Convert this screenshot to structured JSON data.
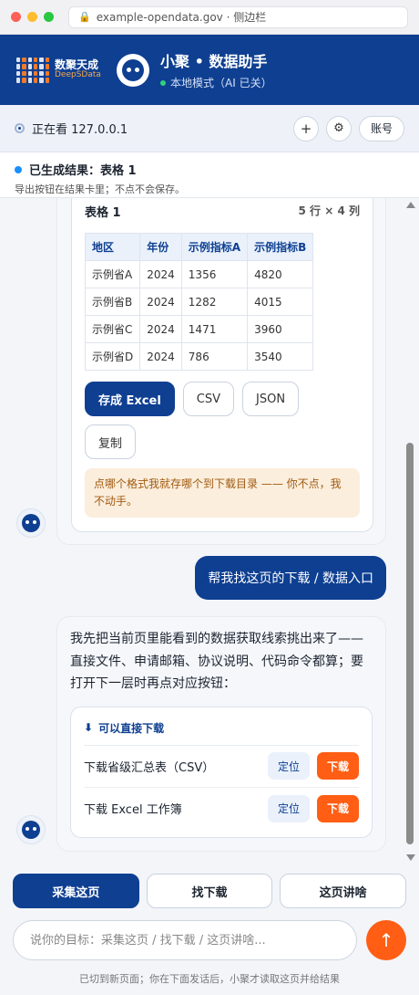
{
  "browser": {
    "url": "example-opendata.gov · 侧边栏"
  },
  "header": {
    "logo_cn": "数聚天成",
    "logo_en": "DeepSData",
    "title": "小聚 • 数据助手",
    "status": "本地模式（AI 已关）"
  },
  "viewbar": {
    "viewing": "正在看 127.0.0.1",
    "add_icon": "plus-icon",
    "settings_icon": "gear-icon",
    "account_label": "账号"
  },
  "banner": {
    "title": "已生成结果：表格 1",
    "subtitle": "导出按钮在结果卡里；不点不会保存。"
  },
  "table_card": {
    "title": "表格 1",
    "meta": "5 行 × 4 列",
    "columns": [
      "地区",
      "年份",
      "示例指标A",
      "示例指标B"
    ],
    "rows": [
      [
        "示例省A",
        "2024",
        "1356",
        "4820"
      ],
      [
        "示例省B",
        "2024",
        "1282",
        "4015"
      ],
      [
        "示例省C",
        "2024",
        "1471",
        "3960"
      ],
      [
        "示例省D",
        "2024",
        "786",
        "3540"
      ]
    ],
    "buttons": {
      "excel": "存成 Excel",
      "csv": "CSV",
      "json": "JSON",
      "copy": "复制"
    },
    "note": "点哪个格式我就存哪个到下载目录 —— 你不点，我不动手。"
  },
  "user_message": "帮我找这页的下载 / 数据入口",
  "bot_message": {
    "text": "我先把当前页里能看到的数据获取线索挑出来了——直接文件、申请邮箱、协议说明、代码命令都算；要打开下一层时再点对应按钮：",
    "section_title": "可以直接下载",
    "items": [
      {
        "name": "下载省级汇总表（CSV）",
        "locate": "定位",
        "download": "下载"
      },
      {
        "name": "下载 Excel 工作簿",
        "locate": "定位",
        "download": "下载"
      }
    ]
  },
  "quick_actions": {
    "collect": "采集这页",
    "find_download": "找下载",
    "explain": "这页讲啥"
  },
  "input": {
    "placeholder": "说你的目标：采集这页 / 找下载 / 这页讲啥...",
    "send_icon": "arrow-up-icon"
  },
  "footer": "已切到新页面；你在下面发话后，小聚才读取这页并给结果"
}
